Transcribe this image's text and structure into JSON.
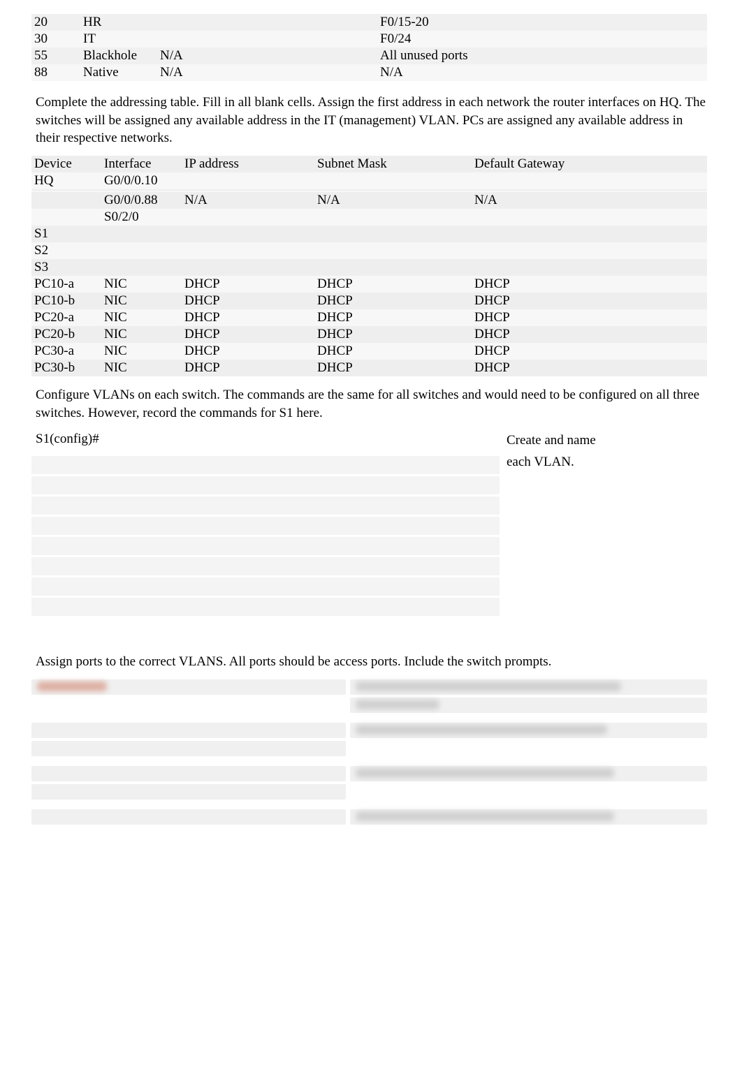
{
  "vlan_table": {
    "rows": [
      {
        "id": "20",
        "name": "HR",
        "col3": "",
        "ports": "F0/15-20"
      },
      {
        "id": "30",
        "name": "IT",
        "col3": "",
        "ports": "F0/24"
      },
      {
        "id": "55",
        "name": "Blackhole",
        "col3": "N/A",
        "ports": "All unused ports"
      },
      {
        "id": "88",
        "name": "Native",
        "col3": "N/A",
        "ports": "N/A"
      }
    ]
  },
  "para1": "Complete the addressing table. Fill in all blank cells. Assign the first address in each network the router interfaces on HQ. The switches will be assigned any available address in the IT (management) VLAN. PCs are assigned any available address in their respective networks.",
  "addressing_table": {
    "headers": {
      "device": "Device",
      "interface": "Interface",
      "ip": "IP address",
      "mask": "Subnet Mask",
      "gw": "Default Gateway"
    },
    "rows": [
      {
        "device": "HQ",
        "interface": "G0/0/0.10",
        "ip": "",
        "mask": "",
        "gw": ""
      },
      {
        "device": "",
        "interface": "",
        "ip": "",
        "mask": "",
        "gw": ""
      },
      {
        "device": "",
        "interface": "",
        "ip": "",
        "mask": "",
        "gw": ""
      },
      {
        "device": "",
        "interface": "G0/0/0.88",
        "ip": "N/A",
        "mask": "N/A",
        "gw": "N/A"
      },
      {
        "device": "",
        "interface": "S0/2/0",
        "ip": "",
        "mask": "",
        "gw": ""
      },
      {
        "device": "S1",
        "interface": "",
        "ip": "",
        "mask": "",
        "gw": ""
      },
      {
        "device": "S2",
        "interface": "",
        "ip": "",
        "mask": "",
        "gw": ""
      },
      {
        "device": "S3",
        "interface": "",
        "ip": "",
        "mask": "",
        "gw": ""
      },
      {
        "device": "PC10-a",
        "interface": "NIC",
        "ip": "DHCP",
        "mask": "DHCP",
        "gw": "DHCP"
      },
      {
        "device": "PC10-b",
        "interface": "NIC",
        "ip": "DHCP",
        "mask": "DHCP",
        "gw": "DHCP"
      },
      {
        "device": "PC20-a",
        "interface": "NIC",
        "ip": "DHCP",
        "mask": "DHCP",
        "gw": "DHCP"
      },
      {
        "device": "PC20-b",
        "interface": "NIC",
        "ip": "DHCP",
        "mask": "DHCP",
        "gw": "DHCP"
      },
      {
        "device": "PC30-a",
        "interface": "NIC",
        "ip": "DHCP",
        "mask": "DHCP",
        "gw": "DHCP"
      },
      {
        "device": "PC30-b",
        "interface": "NIC",
        "ip": "DHCP",
        "mask": "DHCP",
        "gw": "DHCP"
      }
    ]
  },
  "para2": "Configure VLANs on each switch.  The commands are the same for all switches and would need to be configured on all three switches.  However, record the commands for S1 here.",
  "config": {
    "prompt": "S1(config)#",
    "note_line1": "Create and name",
    "note_line2": "each VLAN."
  },
  "para3": "Assign ports to the correct VLANS. All ports should be access ports. Include the switch prompts."
}
